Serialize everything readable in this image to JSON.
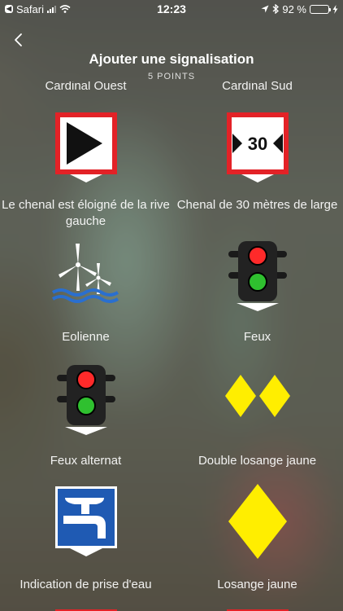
{
  "status_bar": {
    "carrier": "Safari",
    "time": "12:23",
    "battery": "92 %",
    "battery_level": 0.92
  },
  "header": {
    "title": "Ajouter une signalisation",
    "subtitle": "5 POINTS"
  },
  "signs": [
    {
      "label": "Cardinal Ouest",
      "icon": "cardinal-ouest-icon"
    },
    {
      "label": "Cardinal Sud",
      "icon": "cardinal-sud-icon"
    },
    {
      "label": "Le chenal est éloigné de la rive gauche",
      "icon": "chenal-eloigne-rive-gauche-icon"
    },
    {
      "label": "Chenal de 30 mètres de large",
      "icon": "chenal-30-metres-icon",
      "text": "30"
    },
    {
      "label": "Eolienne",
      "icon": "wind-turbine-icon"
    },
    {
      "label": "Feux",
      "icon": "traffic-light-icon"
    },
    {
      "label": "Feux alternat",
      "icon": "alternating-lights-icon"
    },
    {
      "label": "Double losange jaune",
      "icon": "double-yellow-diamond-icon"
    },
    {
      "label": "Indication de prise d'eau",
      "icon": "water-tap-icon"
    },
    {
      "label": "Losange jaune",
      "icon": "yellow-diamond-icon"
    }
  ],
  "colors": {
    "sign_red": "#e32227",
    "sign_yellow": "#ffee00",
    "sign_blue": "#1f5ab3",
    "battery_green": "#4cd964"
  }
}
